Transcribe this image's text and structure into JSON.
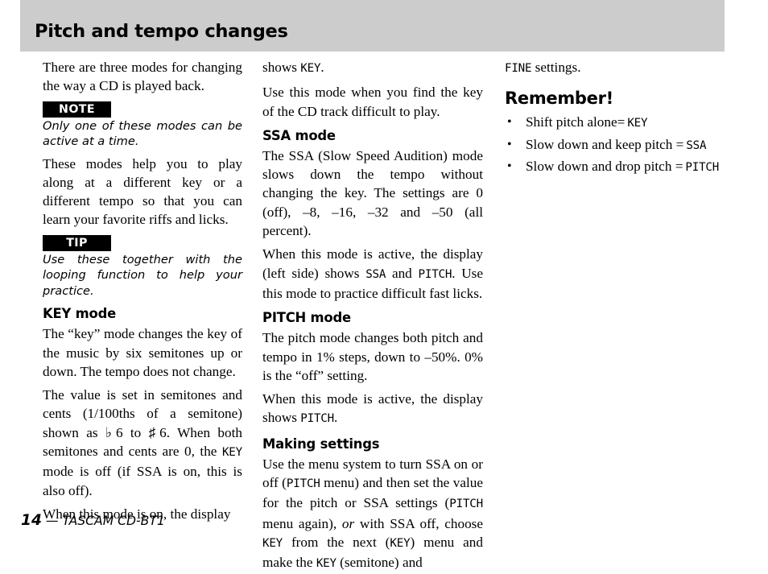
{
  "header": {
    "title": "Pitch and tempo changes",
    "band_color": "#cccccc"
  },
  "left_column": {
    "intro": "There are three modes for changing the way a CD is played back.",
    "note_badge": "NOTE",
    "note_body": "Only one of these modes can be active at a time.",
    "para_modes_help": "These modes help you to play along at a different key or a different tempo so that you can learn your favorite riffs and licks.",
    "tip_badge": "TIP",
    "tip_body": "Use these together with the looping function to help your practice.",
    "key_mode_heading": "KEY mode",
    "key_mode_p1": "The “key” mode changes the key of the music by six semitones up or down. The tempo does not change.",
    "key_mode_p2_a": "The value is set in semitones and cents (1/100ths of a semitone) shown as ♭6 to ♯6. When both semitones and cents are 0, the ",
    "key_mode_p2_lcd": "KEY",
    "key_mode_p2_b": " mode is off (if SSA is on, this is also off).",
    "key_mode_p3": "When this mode is on, the display"
  },
  "mid_column": {
    "shows_key_a": "shows ",
    "shows_key_lcd": "KEY",
    "shows_key_b": ".",
    "use_this_mode": "Use this mode when you find the key of the CD track difficult to play.",
    "ssa_heading": "SSA mode",
    "ssa_p1": "The SSA (Slow Speed Audition) mode slows down the tempo without changing the key. The settings are 0 (off), –8, –16, –32 and –50 (all percent).",
    "ssa_p2_a": "When this mode is active, the display (left side) shows ",
    "ssa_p2_lcd1": "SSA",
    "ssa_p2_b": " and ",
    "ssa_p2_lcd2": "PITCH",
    "ssa_p2_c": ". Use this mode to practice difficult fast licks.",
    "pitch_heading": "PITCH mode",
    "pitch_p1": "The pitch mode changes both pitch and tempo in 1% steps, down to –50%. 0% is the “off” setting.",
    "pitch_p2_a": "When this mode is active, the display shows ",
    "pitch_p2_lcd": "PITCH",
    "pitch_p2_b": ".",
    "making_heading": "Making settings",
    "making_p_a": "Use the menu system to turn SSA on or off (",
    "making_lcd1": "PITCH",
    "making_p_b": " menu) and then set the value for the pitch or SSA settings (",
    "making_lcd2": "PITCH",
    "making_p_c": " menu again), ",
    "making_p_or": "or",
    "making_p_d": " with SSA off, choose ",
    "making_lcd3": "KEY",
    "making_p_e": " from the next (",
    "making_lcd4": "KEY",
    "making_p_f": ") menu and make the ",
    "making_lcd5": "KEY",
    "making_p_g": " (semitone) and"
  },
  "right_column": {
    "fine_lcd": "FINE",
    "fine_rest": " settings.",
    "remember_heading": "Remember!",
    "bullets": [
      {
        "bullet": "•",
        "text": "Shift pitch alone=",
        "lcd": "KEY",
        "gap": ""
      },
      {
        "bullet": "•",
        "text": "Slow down and keep pitch =",
        "lcd": "SSA",
        "gap": " "
      },
      {
        "bullet": "•",
        "text": "Slow down and drop pitch =",
        "lcd": "PITCH",
        "gap": " "
      }
    ]
  },
  "footer": {
    "page_number": "14",
    "separator": "—",
    "publication": "TASCAM CD-BT1"
  }
}
